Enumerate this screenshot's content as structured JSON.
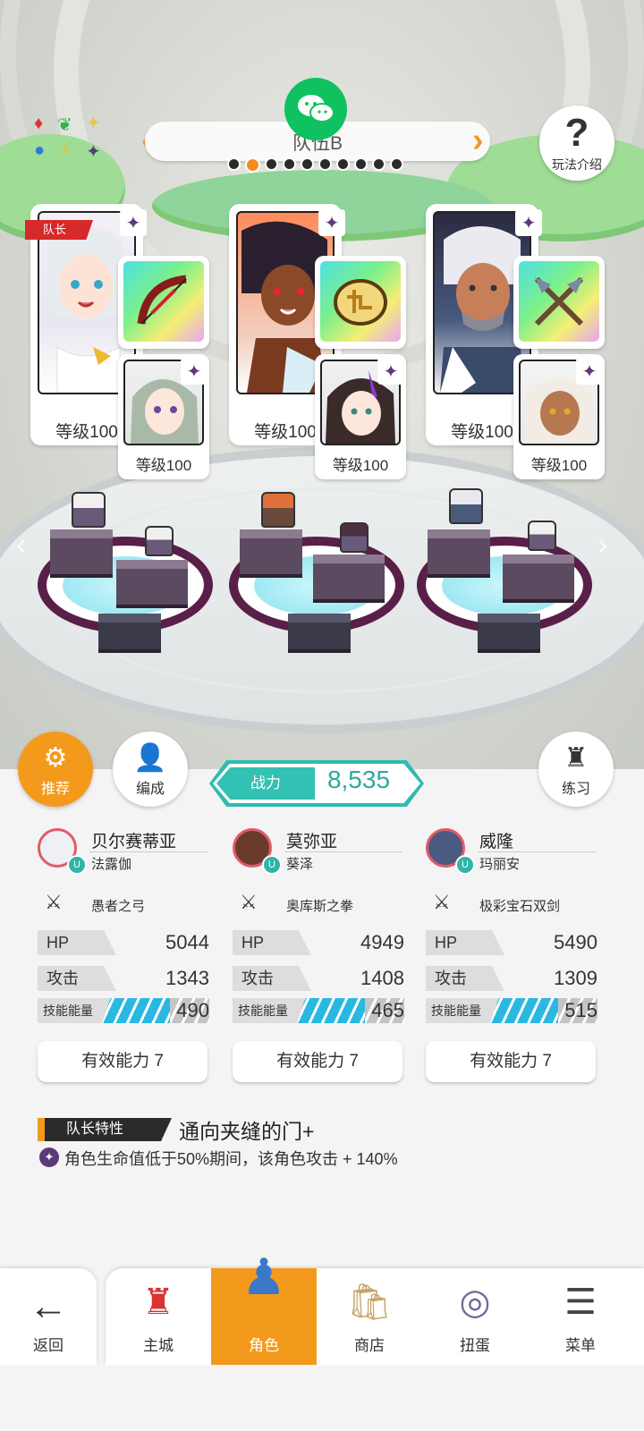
{
  "team": {
    "name": "队伍B",
    "page_count": 10,
    "active_page": 2,
    "help_label": "玩法介绍"
  },
  "cards": [
    {
      "main_level": "等级100",
      "leader_tag": "队长",
      "weapon_icon": "bow-icon",
      "sub_level": "等级100"
    },
    {
      "main_level": "等级100",
      "weapon_icon": "fist-relic-icon",
      "sub_level": "等级100"
    },
    {
      "main_level": "等级100",
      "weapon_icon": "crossed-swords-icon",
      "sub_level": "等级100"
    }
  ],
  "actions": {
    "recommend": "推荐",
    "formation": "编成",
    "practice": "练习",
    "power_label": "战力",
    "power_value": "8,535"
  },
  "characters": [
    {
      "name": "贝尔赛蒂亚",
      "partner": "法露伽",
      "weapon": "愚者之弓",
      "hp_label": "HP",
      "hp": "5044",
      "atk_label": "攻击",
      "atk": "1343",
      "energy_label": "技能能量",
      "energy": "490",
      "ability": "有效能力 7"
    },
    {
      "name": "莫弥亚",
      "partner": "葵泽",
      "weapon": "奥库斯之拳",
      "hp_label": "HP",
      "hp": "4949",
      "atk_label": "攻击",
      "atk": "1408",
      "energy_label": "技能能量",
      "energy": "465",
      "ability": "有效能力 7"
    },
    {
      "name": "威隆",
      "partner": "玛丽安",
      "weapon": "极彩宝石双剑",
      "hp_label": "HP",
      "hp": "5490",
      "atk_label": "攻击",
      "atk": "1309",
      "energy_label": "技能能量",
      "energy": "515",
      "ability": "有效能力 7"
    }
  ],
  "leader": {
    "label": "队长特性",
    "skill": "通向夹缝的门+",
    "desc": "角色生命值低于50%期间，该角色攻击 + 140%"
  },
  "nav": {
    "back": "返回",
    "items": [
      "主城",
      "角色",
      "商店",
      "扭蛋",
      "菜单"
    ],
    "active": "角色"
  },
  "colors": {
    "accent": "#f39a1d",
    "teal": "#2fbcae",
    "leader_red": "#d62929"
  }
}
